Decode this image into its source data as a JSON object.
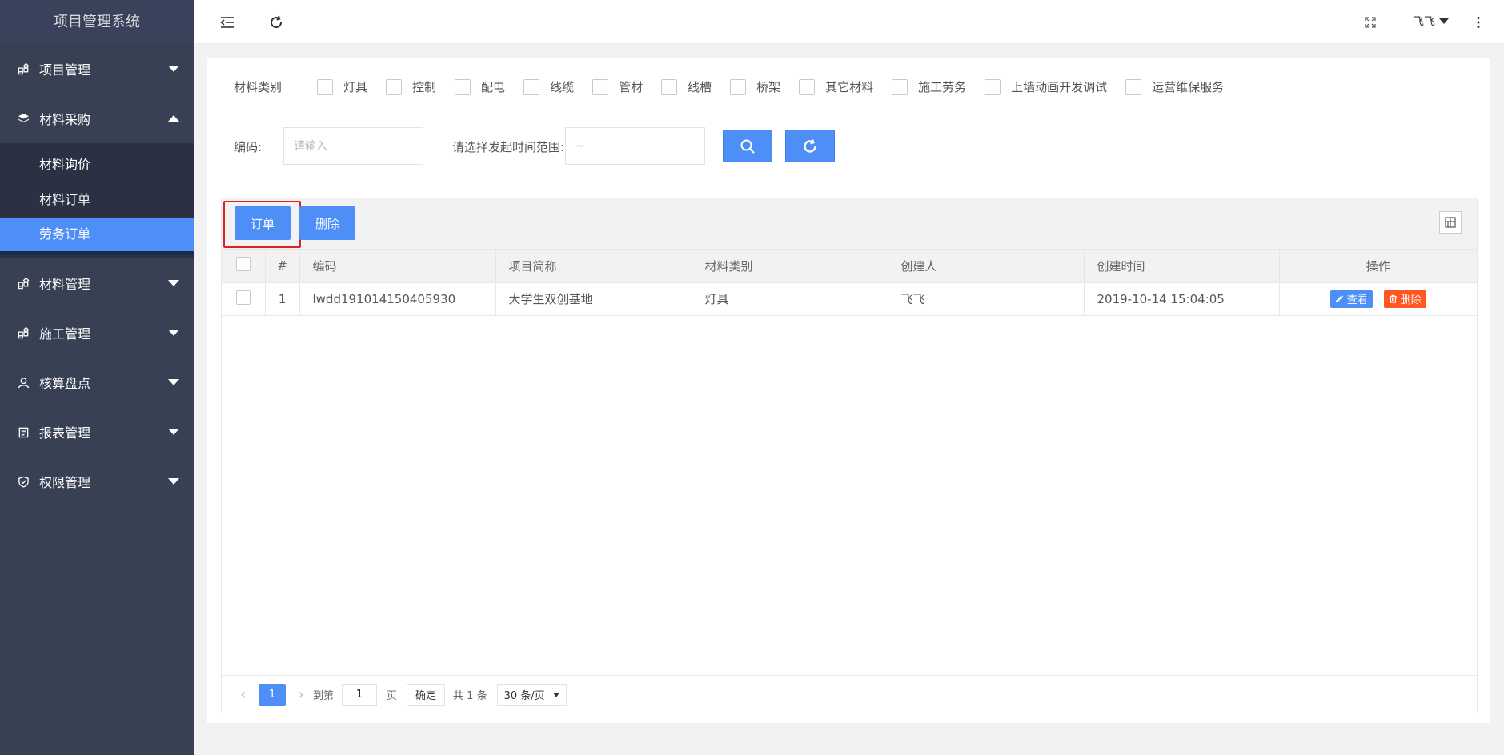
{
  "app": {
    "title": "项目管理系统"
  },
  "sidebar": {
    "items": [
      {
        "label": "项目管理",
        "icon": "grid-icon",
        "expanded": false
      },
      {
        "label": "材料采购",
        "icon": "layers-icon",
        "expanded": true,
        "children": [
          {
            "label": "材料询价",
            "active": false
          },
          {
            "label": "材料订单",
            "active": false
          },
          {
            "label": "劳务订单",
            "active": true
          }
        ]
      },
      {
        "label": "材料管理",
        "icon": "grid-icon",
        "expanded": false
      },
      {
        "label": "施工管理",
        "icon": "grid-icon",
        "expanded": false
      },
      {
        "label": "核算盘点",
        "icon": "user-icon",
        "expanded": false
      },
      {
        "label": "报表管理",
        "icon": "clipboard-icon",
        "expanded": false
      },
      {
        "label": "权限管理",
        "icon": "shield-check-icon",
        "expanded": false
      }
    ]
  },
  "header": {
    "user": "飞飞",
    "icons": [
      "menu-fold-icon",
      "refresh-icon",
      "fullscreen-icon",
      "more-vertical-icon"
    ]
  },
  "filters": {
    "category_label": "材料类别",
    "categories": [
      "灯具",
      "控制",
      "配电",
      "线缆",
      "管材",
      "线槽",
      "桥架",
      "其它材料",
      "施工劳务",
      "上墙动画开发调试",
      "运营维保服务"
    ],
    "code_label": "编码:",
    "code_placeholder": "请输入",
    "date_label": "请选择发起时间范围:",
    "date_placeholder": "~"
  },
  "toolbar": {
    "order_label": "订单",
    "delete_label": "删除"
  },
  "table": {
    "columns": [
      "#",
      "编码",
      "项目简称",
      "材料类别",
      "创建人",
      "创建时间",
      "操作"
    ],
    "rows": [
      {
        "num": "1",
        "code": "lwdd191014150405930",
        "project": "大学生双创基地",
        "category": "灯具",
        "creator": "飞飞",
        "created": "2019-10-14 15:04:05"
      }
    ],
    "actions": {
      "view": "查看",
      "delete": "删除"
    }
  },
  "pagination": {
    "current_page": "1",
    "goto_label": "到第",
    "goto_value": "1",
    "page_unit": "页",
    "confirm": "确定",
    "total": "共 1 条",
    "page_size": "30 条/页"
  },
  "colors": {
    "sidebar": "#384053",
    "accent": "#4e8ef7",
    "danger": "#ff5722",
    "highlight": "#e02020"
  }
}
